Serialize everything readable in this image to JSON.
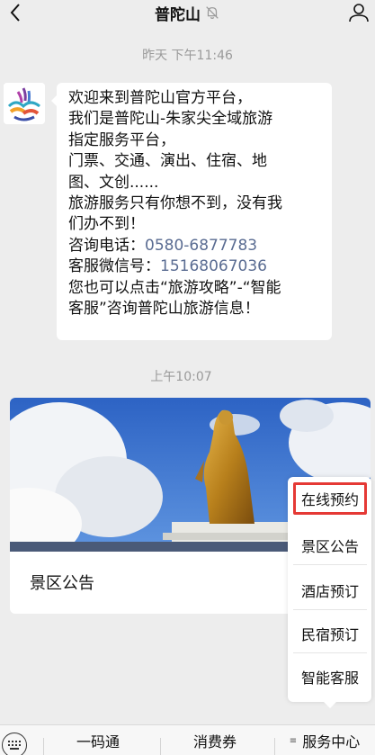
{
  "header": {
    "title": "普陀山",
    "back_icon": "chevron-left-icon",
    "mute_icon": "bell-off-icon",
    "profile_icon": "person-icon"
  },
  "timestamps": [
    "昨天 下午11:46",
    "上午10:07"
  ],
  "message": {
    "lines": [
      "欢迎来到普陀山官方平台，",
      "我们是普陀山-朱家尖全域旅游",
      "指定服务平台，",
      "门票、交通、演出、住宿、地",
      "图、文创......",
      "旅游服务只有你想不到，没有我",
      "们办不到！"
    ],
    "phone_label": "咨询电话：",
    "phone": "0580-6877783",
    "wechat_label": "客服微信号：",
    "wechat": "15168067036",
    "tail_lines": [
      "您也可以点击“旅游攻略”-“智能",
      "客服”咨询普陀山旅游信息！"
    ]
  },
  "card": {
    "title": "景区公告"
  },
  "popup_menu": {
    "items": [
      "在线预约",
      "景区公告",
      "酒店预订",
      "民宿预订",
      "智能客服"
    ],
    "highlighted_index": 0
  },
  "bottom_menu": {
    "items": [
      "一码通",
      "消费券",
      "服务中心"
    ]
  },
  "colors": {
    "background": "#ededed",
    "link": "#5a6c92",
    "highlight": "#e53935"
  }
}
